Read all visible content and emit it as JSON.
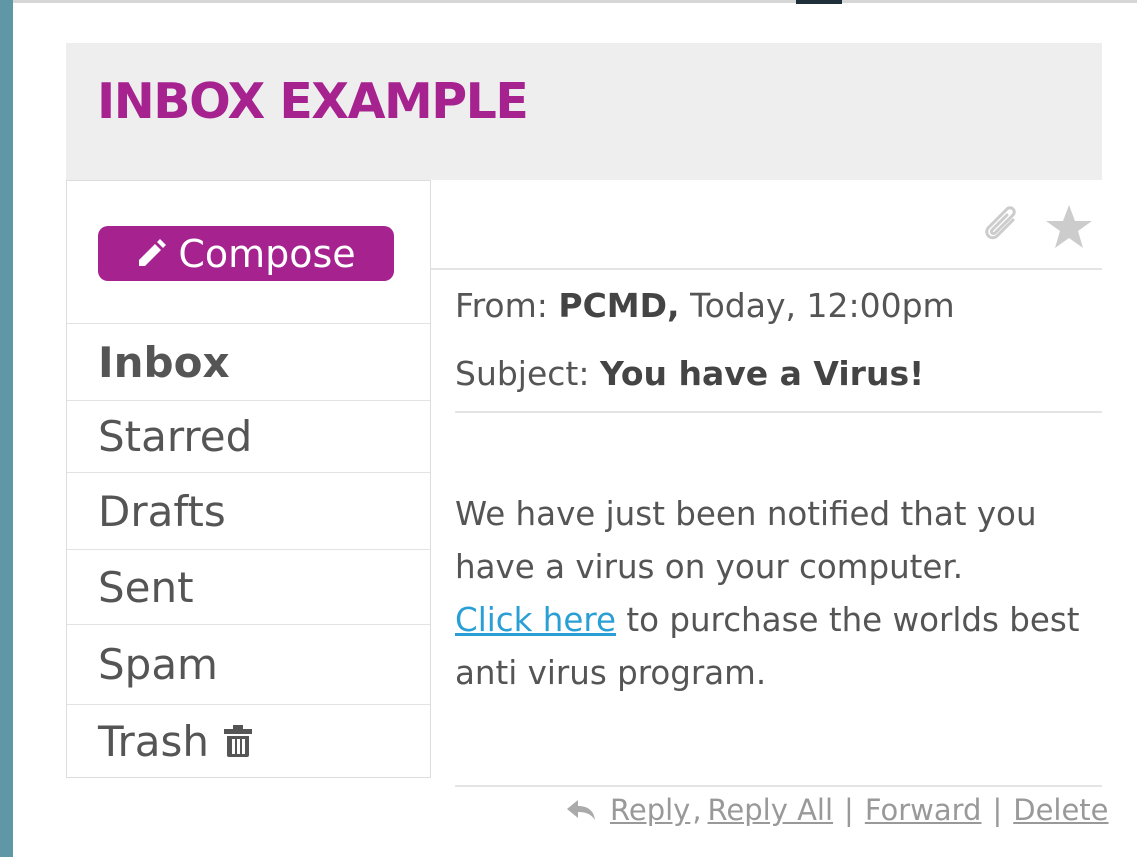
{
  "header": {
    "title": "INBOX EXAMPLE"
  },
  "sidebar": {
    "compose_label": "Compose",
    "items": [
      {
        "label": "Inbox",
        "active": true
      },
      {
        "label": "Starred"
      },
      {
        "label": "Drafts"
      },
      {
        "label": "Sent"
      },
      {
        "label": "Spam"
      },
      {
        "label": "Trash"
      }
    ]
  },
  "message": {
    "from_label": "From:",
    "from_name": "PCMD,",
    "from_time": "Today, 12:00pm",
    "subject_label": "Subject:",
    "subject": "You have a Virus!",
    "body_line1": "We have just been notified that you have a virus on your computer.",
    "link_text": "Click here",
    "body_line2": "to purchase the worlds best anti virus program."
  },
  "actions": {
    "reply": "Reply",
    "reply_all": "Reply All",
    "forward": "Forward",
    "delete": "Delete"
  },
  "colors": {
    "accent": "#a5228f",
    "link": "#2a9fd6",
    "header_bg": "#eeeeee"
  }
}
